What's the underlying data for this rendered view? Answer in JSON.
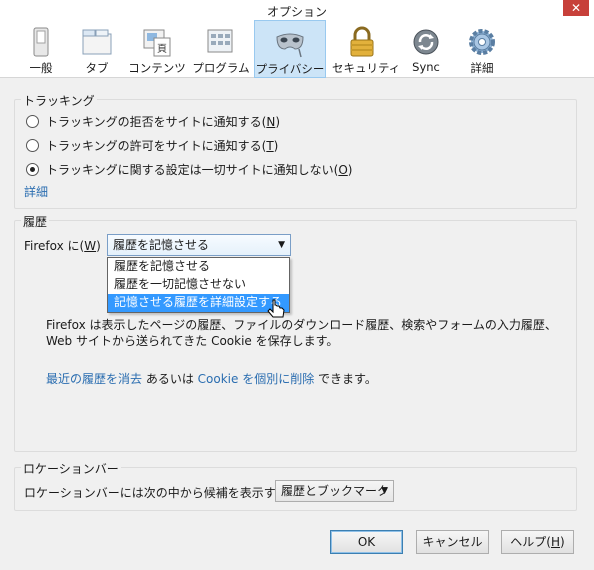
{
  "window": {
    "title": "オプション",
    "close_glyph": "✕"
  },
  "toolbar": {
    "items": [
      {
        "label": "一般",
        "icon": "switch-icon"
      },
      {
        "label": "タブ",
        "icon": "tabs-icon"
      },
      {
        "label": "コンテンツ",
        "icon": "content-icon"
      },
      {
        "label": "プログラム",
        "icon": "applications-icon"
      },
      {
        "label": "プライバシー",
        "icon": "mask-icon",
        "selected": true
      },
      {
        "label": "セキュリティ",
        "icon": "lock-icon"
      },
      {
        "label": "Sync",
        "icon": "sync-icon"
      },
      {
        "label": "詳細",
        "icon": "gear-icon"
      }
    ]
  },
  "tracking": {
    "legend": "トラッキング",
    "options": [
      {
        "pre": "トラッキングの拒否をサイトに通知する(",
        "key": "N",
        "post": ")",
        "checked": false
      },
      {
        "pre": "トラッキングの許可をサイトに通知する(",
        "key": "T",
        "post": ")",
        "checked": false
      },
      {
        "pre": "トラッキングに関する設定は一切サイトに通知しない(",
        "key": "O",
        "post": ")",
        "checked": true
      }
    ],
    "details_link": "詳細"
  },
  "history": {
    "legend": "履歴",
    "label_pre": "Firefox に(",
    "label_key": "W",
    "label_post": ")",
    "selected": "履歴を記憶させる",
    "options": [
      "履歴を記憶させる",
      "履歴を一切記憶させない",
      "記憶させる履歴を詳細設定する"
    ],
    "highlighted_index": 2,
    "description": "Firefox は表示したページの履歴、ファイルのダウンロード履歴、検索やフォームの入力履歴、Web サイトから送られてきた Cookie を保存します。",
    "link_clear": "最近の履歴を消去",
    "text_or": " あるいは ",
    "link_cookies": "Cookie を個別に削除",
    "text_end": " できます。"
  },
  "location_bar": {
    "legend": "ロケーションバー",
    "label_pre": "ロケーションバーには次の中から候補を表示する(",
    "label_key": "U",
    "label_post": "):",
    "selected": "履歴とブックマーク"
  },
  "buttons": {
    "ok": "OK",
    "cancel": "キャンセル",
    "help_pre": "ヘルプ(",
    "help_key": "H",
    "help_post": ")"
  }
}
